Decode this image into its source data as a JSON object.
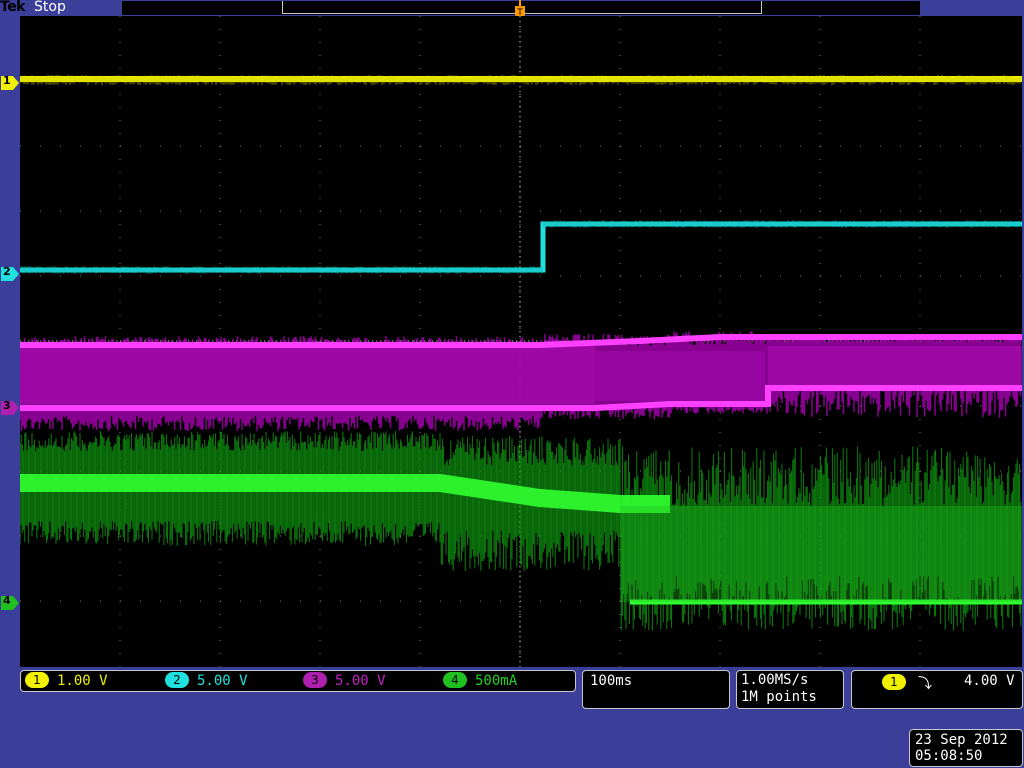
{
  "header": {
    "brand": "Tek",
    "acq_state": "Stop"
  },
  "trigger": {
    "position_marker_label": "T",
    "source_channel": "1",
    "slope_icon": "falling-edge-icon",
    "slope_glyph": "⤵",
    "level": "4.00 V"
  },
  "channels": [
    {
      "id": "1",
      "scale": "1.00 V",
      "color": "#f0f000"
    },
    {
      "id": "2",
      "scale": "5.00 V",
      "color": "#20e0e0"
    },
    {
      "id": "3",
      "scale": "5.00 V",
      "color": "#e020e0"
    },
    {
      "id": "4",
      "scale": "500mA",
      "color": "#20f020"
    }
  ],
  "timebase": {
    "scale": "100ms"
  },
  "acquisition": {
    "sample_rate": "1.00MS/s",
    "record_length": "1M points"
  },
  "timestamp": {
    "date": "23 Sep  2012",
    "time": "05:08:50"
  },
  "colors": {
    "frame": "#3c3f99",
    "screen": "#000000",
    "ch1": "#f0f000",
    "ch2": "#20e0e0",
    "ch3": "#e020e0",
    "ch4": "#20f020"
  }
}
